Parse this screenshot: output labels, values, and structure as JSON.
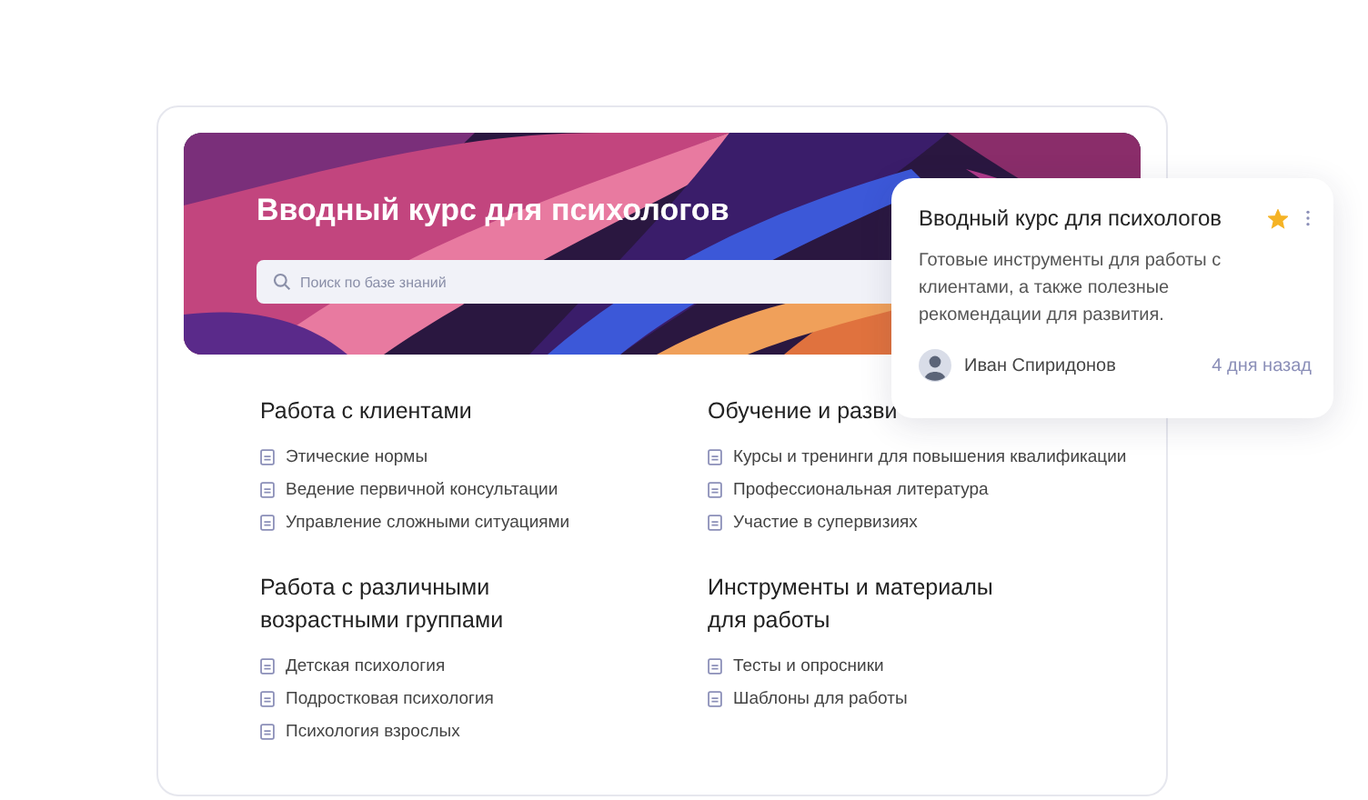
{
  "banner": {
    "title": "Вводный курс для психологов",
    "search": {
      "placeholder": "Поиск по базе знаний"
    }
  },
  "sections": [
    {
      "title": "Работа с клиентами",
      "items": [
        "Этические нормы",
        "Ведение первичной консультации",
        "Управление сложными ситуациями"
      ]
    },
    {
      "title": "Обучение и разви",
      "items": [
        "Курсы и тренинги для повышения квалификации",
        "Профессиональная литература",
        "Участие в супервизиях"
      ]
    },
    {
      "title": "Работа с различными возрастными группами",
      "items": [
        "Детская психология",
        "Подростковая психология",
        "Психология взрослых"
      ]
    },
    {
      "title": "Инструменты и материалы для работы",
      "items": [
        "Тесты и опросники",
        "Шаблоны для работы"
      ]
    }
  ],
  "popup": {
    "title": "Вводный курс для психологов",
    "favorite": true,
    "description": "Готовые инструменты для работы с клиентами, а также полезные рекомендации для развития.",
    "author": "Иван Спиридонов",
    "time": "4 дня назад"
  }
}
